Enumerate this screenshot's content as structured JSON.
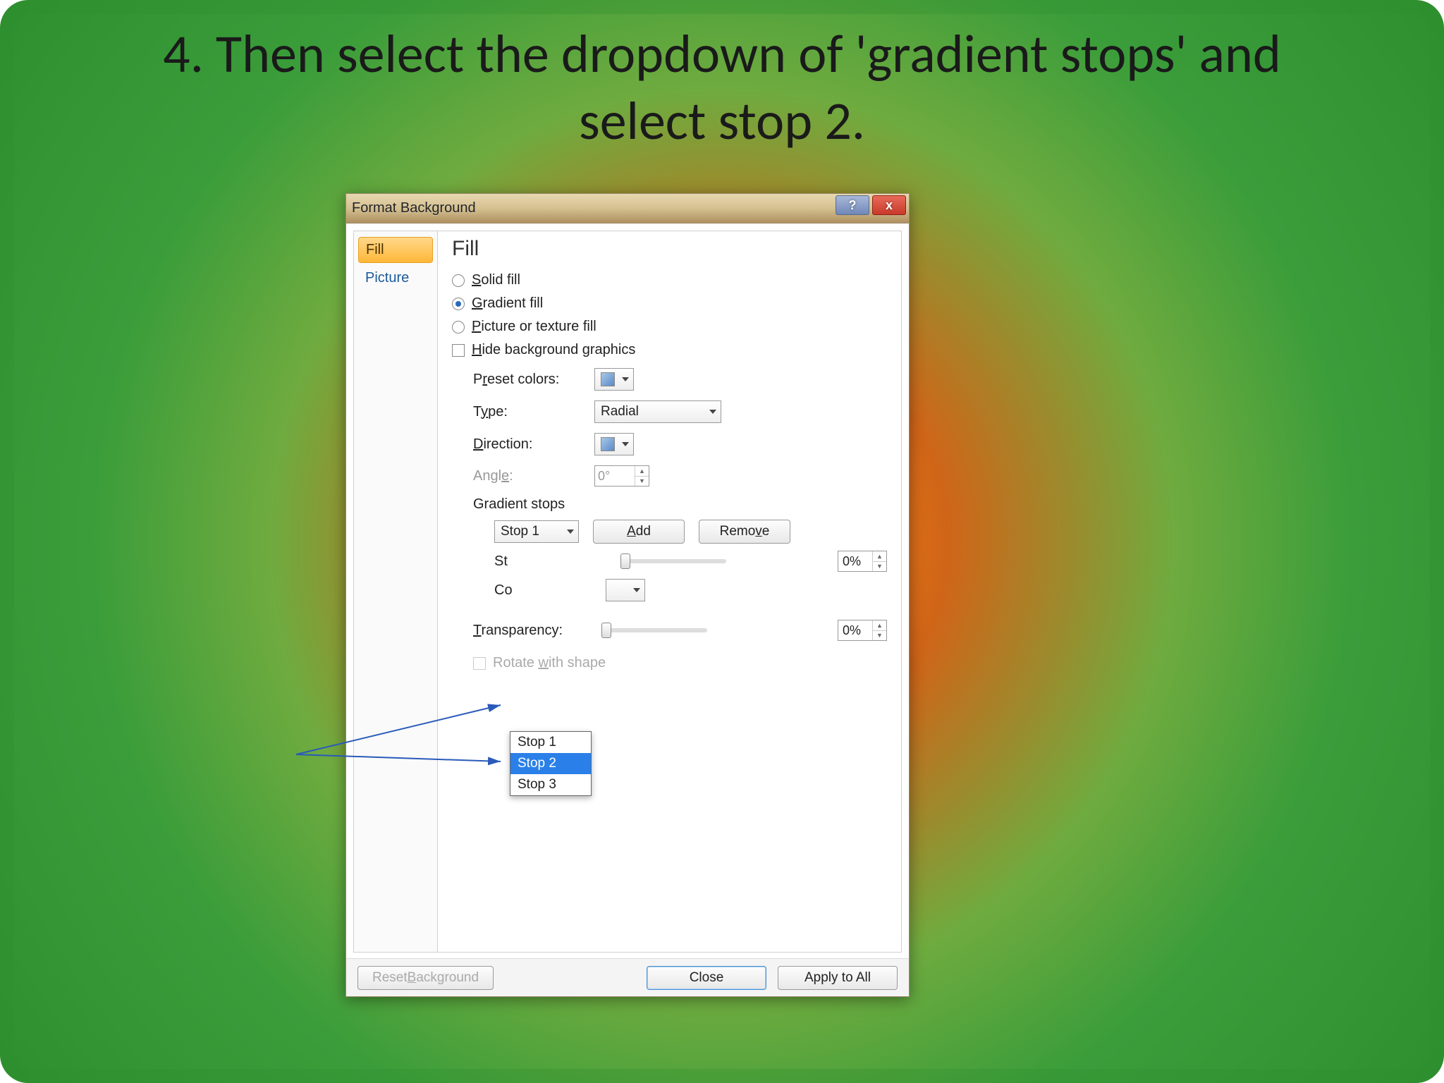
{
  "slide": {
    "title": "4. Then select the dropdown of 'gradient stops' and select stop 2."
  },
  "dialog": {
    "title": "Format Background",
    "help_symbol": "?",
    "close_symbol": "x",
    "sidebar": {
      "items": [
        {
          "label": "Fill",
          "active": true
        },
        {
          "label": "Picture",
          "active": false
        }
      ]
    },
    "main": {
      "heading": "Fill",
      "options": {
        "solid": "Solid fill",
        "gradient": "Gradient fill",
        "picture": "Picture or texture fill",
        "hide_bg": "Hide background graphics"
      },
      "preset_label": "Preset colors:",
      "type_label": "Type:",
      "type_value": "Radial",
      "direction_label": "Direction:",
      "angle_label": "Angle:",
      "angle_value": "0°",
      "gradient_stops_label": "Gradient stops",
      "stop_selected": "Stop 1",
      "add_label": "Add",
      "remove_label": "Remove",
      "stop_pos_label_prefix": "St",
      "stop_pos_value": "0%",
      "color_label_prefix": "Co",
      "transparency_label": "Transparency:",
      "transparency_value": "0%",
      "rotate_label": "Rotate with shape",
      "dropdown_items": [
        "Stop 1",
        "Stop 2",
        "Stop 3"
      ],
      "dropdown_highlight_index": 1
    },
    "footer": {
      "reset": "Reset Background",
      "close": "Close",
      "apply": "Apply to All"
    }
  }
}
